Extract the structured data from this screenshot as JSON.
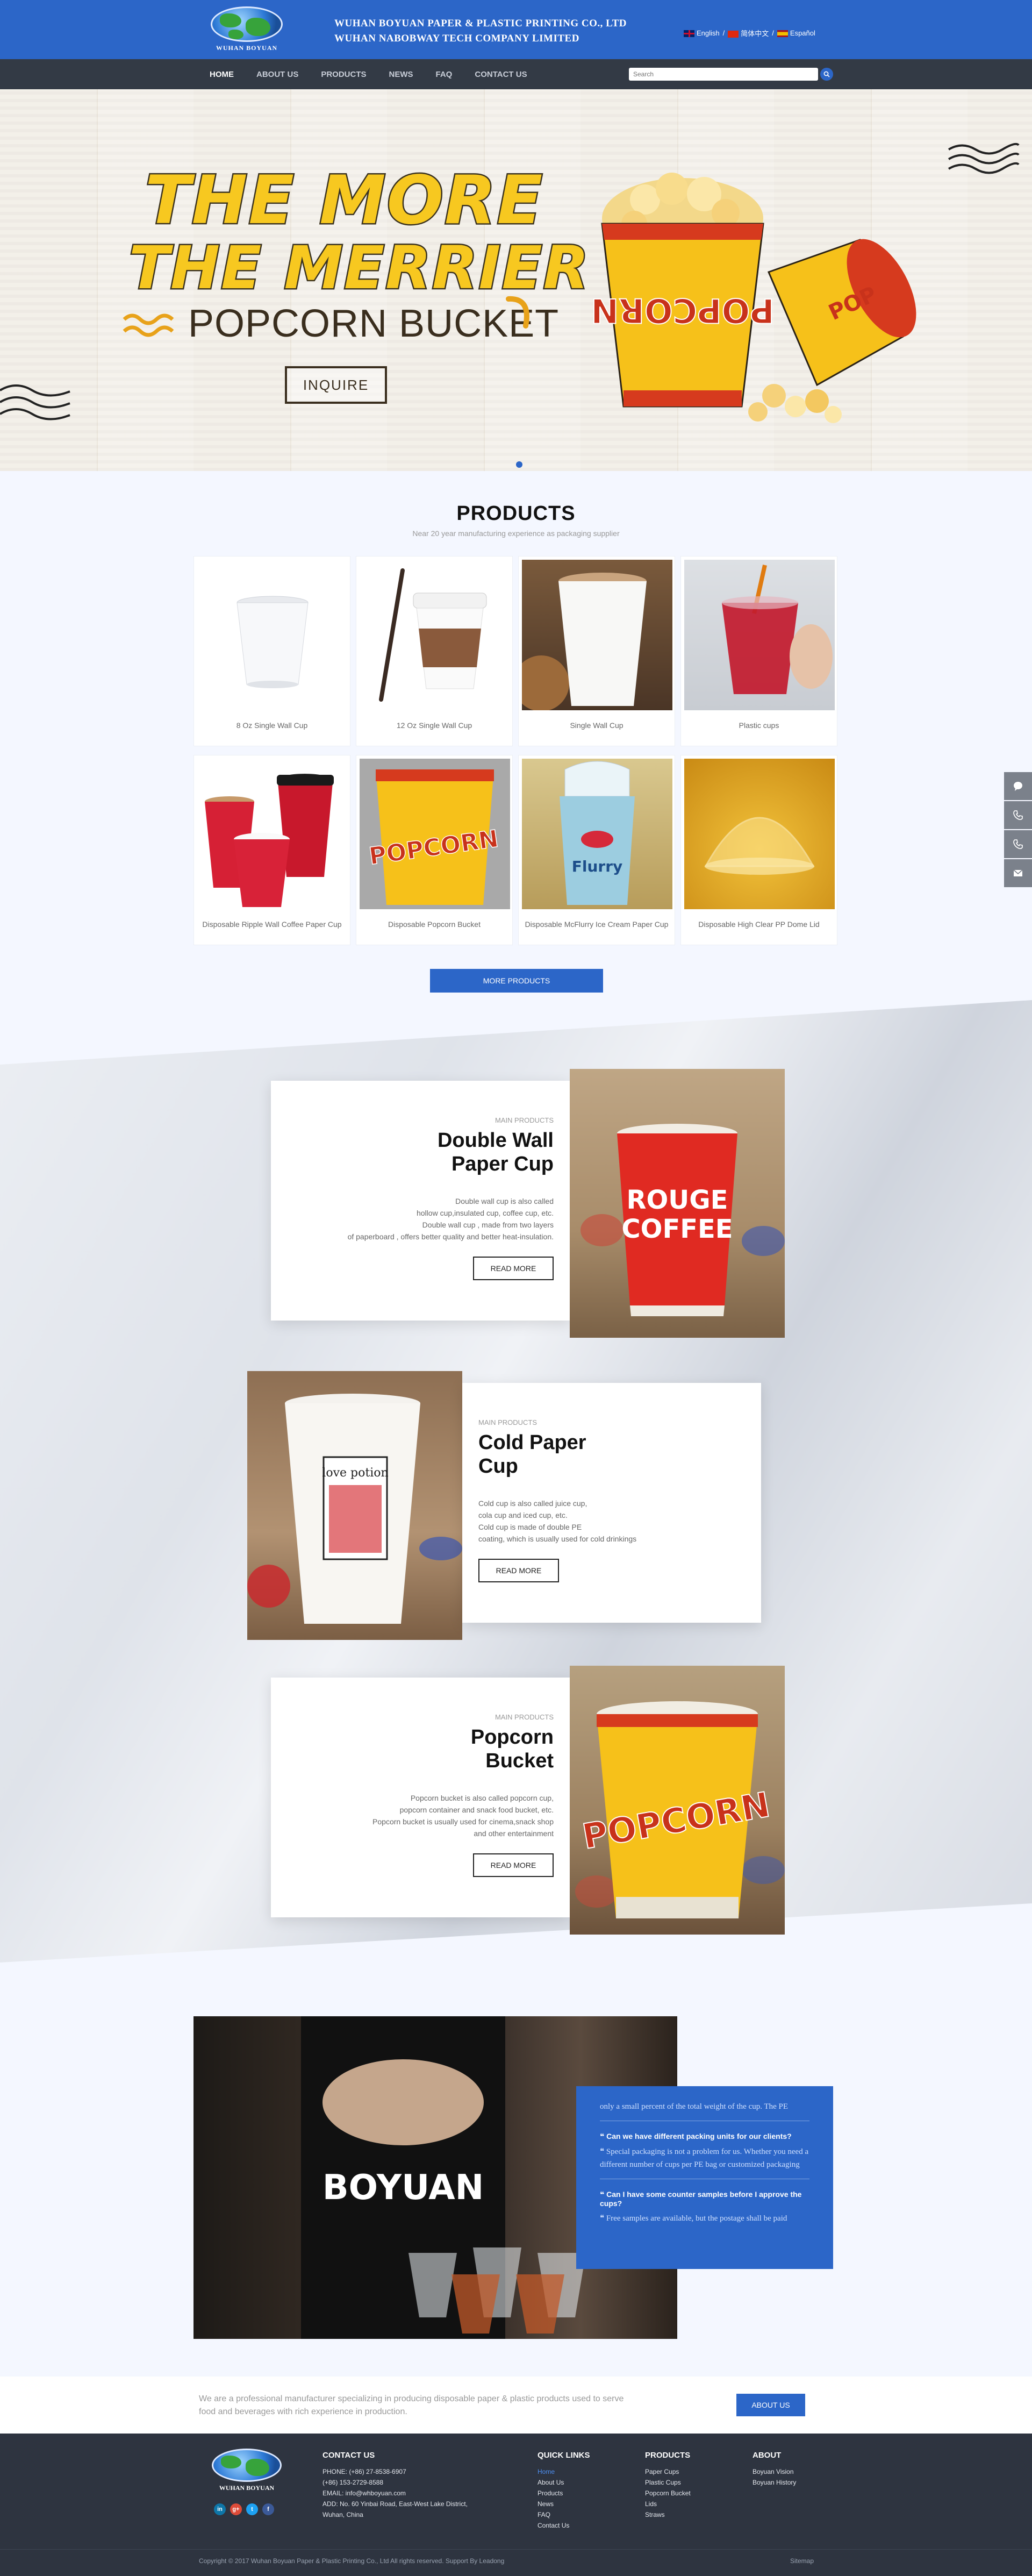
{
  "header": {
    "logo_text": "WUHAN BOYUAN",
    "company_line1": "WUHAN BOYUAN PAPER & PLASTIC PRINTING CO., LTD",
    "company_line2": "WUHAN NABOBWAY TECH COMPANY LIMITED",
    "languages": [
      "English",
      "简体中文",
      "Español"
    ]
  },
  "nav": {
    "items": [
      "HOME",
      "ABOUT US",
      "PRODUCTS",
      "NEWS",
      "FAQ",
      "CONTACT US"
    ],
    "search_placeholder": "Search"
  },
  "banner": {
    "headline1": "THE MORE",
    "headline2": "THE MERRIER",
    "subline": "POPCORN BUCKET",
    "button": "INQUIRE"
  },
  "products": {
    "title": "PRODUCTS",
    "subtitle": "Near 20 year manufacturing experience as packaging supplier",
    "items": [
      "8 Oz Single Wall Cup",
      "12 Oz Single Wall Cup",
      "Single Wall Cup",
      "Plastic cups",
      "Disposable Ripple Wall Coffee Paper Cup",
      "Disposable Popcorn Bucket",
      "Disposable McFlurry Ice Cream Paper Cup",
      "Disposable High Clear PP Dome Lid"
    ],
    "more_button": "MORE PRODUCTS"
  },
  "main_products": [
    {
      "tag": "MAIN PRODUCTS",
      "title_line1": "Double Wall",
      "title_line2": "Paper Cup",
      "desc": [
        "Double wall cup is also called",
        "hollow cup,insulated cup, coffee cup, etc.",
        "Double wall cup , made from two layers",
        "of paperboard , offers better quality and better heat-insulation."
      ],
      "button": "READ MORE",
      "cup_text": [
        "ROUGE",
        "COFFEE"
      ]
    },
    {
      "tag": "MAIN PRODUCTS",
      "title_line1": "Cold Paper",
      "title_line2": "Cup",
      "desc": [
        "Cold cup is also called juice cup,",
        "cola cup and iced cup, etc.",
        "Cold cup is made of double PE",
        "coating, which is usually used for cold drinkings"
      ],
      "button": "READ MORE",
      "cup_text": [
        "love potion"
      ]
    },
    {
      "tag": "MAIN PRODUCTS",
      "title_line1": "Popcorn",
      "title_line2": "Bucket",
      "desc": [
        "Popcorn bucket is also called popcorn cup,",
        "popcorn container and snack food bucket, etc.",
        "Popcorn bucket is usually used for cinema,snack shop",
        "and other entertainment"
      ],
      "button": "READ MORE",
      "cup_text": [
        "POPCORN"
      ]
    }
  ],
  "faq": {
    "photo_text": "BOYUAN",
    "items": [
      {
        "q": "",
        "a": "only a small percent of the total weight of the cup. The PE"
      },
      {
        "q": "Can we have different packing units for our clients?",
        "a": "Special packaging is not a problem for us. Whether you need a different number of cups per PE bag or customized packaging"
      },
      {
        "q": "Can I have some counter samples before I approve the cups?",
        "a": "Free samples are available, but the postage shall be paid"
      }
    ]
  },
  "about_strip": {
    "text": "We are a professional manufacturer specializing in producing disposable paper & plastic products used to serve food and beverages with rich experience in production.",
    "button": "ABOUT US"
  },
  "footer": {
    "logo_text": "WUHAN BOYUAN",
    "contact": {
      "title": "CONTACT US",
      "lines": [
        "PHONE: (+86) 27-8538-6907",
        "(+86) 153-2729-8588",
        "EMAIL: info@whboyuan.com",
        "ADD: No. 60 Yinbai Road, East-West Lake District,",
        "Wuhan, China"
      ]
    },
    "quick_links": {
      "title": "QUICK LINKS",
      "items": [
        "Home",
        "About Us",
        "Products",
        "News",
        "FAQ",
        "Contact Us"
      ]
    },
    "products": {
      "title": "PRODUCTS",
      "items": [
        "Paper Cups",
        "Plastic Cups",
        "Popcorn Bucket",
        "Lids",
        "Straws"
      ]
    },
    "about": {
      "title": "ABOUT",
      "items": [
        "Boyuan Vision",
        "Boyuan History"
      ]
    },
    "social": [
      "in",
      "g+",
      "t",
      "f"
    ],
    "copyright": "Copyright © 2017 Wuhan Boyuan Paper & Plastic Printing Co., Ltd All rights reserved. Support By Leadong",
    "sitemap": "Sitemap"
  },
  "colors": {
    "brand_blue": "#2c66c8",
    "nav_dark": "#333a45",
    "footer_dark": "#2e3440",
    "popcorn_yellow": "#f7c820"
  }
}
